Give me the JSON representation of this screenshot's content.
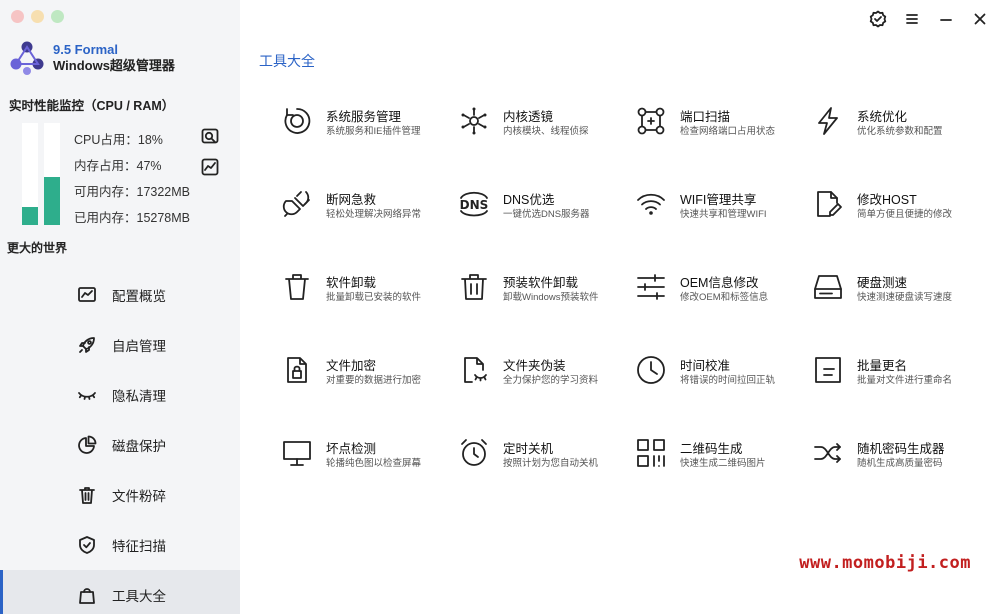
{
  "app": {
    "version": "9.5 Formal",
    "name": "Windows超级管理器",
    "monitor_title": "实时性能监控（CPU / RAM）",
    "slogan": "更大的世界"
  },
  "monitor": {
    "cpu_fraction": 0.18,
    "mem_fraction": 0.47,
    "bar_color": "#2eae8c",
    "stats": [
      {
        "label": "CPU占用：18%"
      },
      {
        "label": "内存占用：47%"
      },
      {
        "label": "可用内存：17322MB"
      },
      {
        "label": "已用内存：15278MB"
      }
    ]
  },
  "nav": [
    {
      "label": "配置概览",
      "icon": "chart-icon"
    },
    {
      "label": "自启管理",
      "icon": "rocket-icon"
    },
    {
      "label": "隐私清理",
      "icon": "eye-closed-icon"
    },
    {
      "label": "磁盘保护",
      "icon": "pie-icon"
    },
    {
      "label": "文件粉碎",
      "icon": "trash-icon"
    },
    {
      "label": "特征扫描",
      "icon": "shield-icon"
    },
    {
      "label": "工具大全",
      "icon": "bag-icon",
      "active": true
    }
  ],
  "page_title": "工具大全",
  "tools": [
    {
      "name": "系统服务管理",
      "desc": "系统服务和IE插件管理",
      "icon": "service-icon"
    },
    {
      "name": "内核透镜",
      "desc": "内核模块、线程侦探",
      "icon": "kernel-icon"
    },
    {
      "name": "端口扫描",
      "desc": "检查网络端口占用状态",
      "icon": "port-scan-icon"
    },
    {
      "name": "系统优化",
      "desc": "优化系统参数和配置",
      "icon": "lightning-icon"
    },
    {
      "name": "断网急救",
      "desc": "轻松处理解决网络异常",
      "icon": "plug-icon"
    },
    {
      "name": "DNS优选",
      "desc": "一键优选DNS服务器",
      "icon": "dns-icon"
    },
    {
      "name": "WIFI管理共享",
      "desc": "快速共享和管理WIFI",
      "icon": "wifi-icon"
    },
    {
      "name": "修改HOST",
      "desc": "简单方便且便捷的修改",
      "icon": "edit-file-icon"
    },
    {
      "name": "软件卸载",
      "desc": "批量卸载已安装的软件",
      "icon": "trash-icon"
    },
    {
      "name": "预装软件卸载",
      "desc": "卸载Windows预装软件",
      "icon": "trash-lines-icon"
    },
    {
      "name": "OEM信息修改",
      "desc": "修改OEM和标签信息",
      "icon": "sliders-icon"
    },
    {
      "name": "硬盘测速",
      "desc": "快速测速硬盘读写速度",
      "icon": "disk-icon"
    },
    {
      "name": "文件加密",
      "desc": "对重要的数据进行加密",
      "icon": "lock-file-icon"
    },
    {
      "name": "文件夹伪装",
      "desc": "全力保护您的学习资料",
      "icon": "mask-file-icon"
    },
    {
      "name": "时间校准",
      "desc": "将错误的时间拉回正轨",
      "icon": "clock-icon"
    },
    {
      "name": "批量更名",
      "desc": "批量对文件进行重命名",
      "icon": "rename-icon"
    },
    {
      "name": "坏点检测",
      "desc": "轮播纯色图以检查屏幕",
      "icon": "monitor-icon"
    },
    {
      "name": "定时关机",
      "desc": "按照计划为您自动关机",
      "icon": "alarm-icon"
    },
    {
      "name": "二维码生成",
      "desc": "快速生成二维码图片",
      "icon": "qrcode-icon"
    },
    {
      "name": "随机密码生成器",
      "desc": "随机生成高质量密码",
      "icon": "shuffle-icon"
    }
  ],
  "watermark": "www.momobiji.com",
  "colors": {
    "accent": "#2b63c6",
    "watermark": "#c21f1f"
  }
}
